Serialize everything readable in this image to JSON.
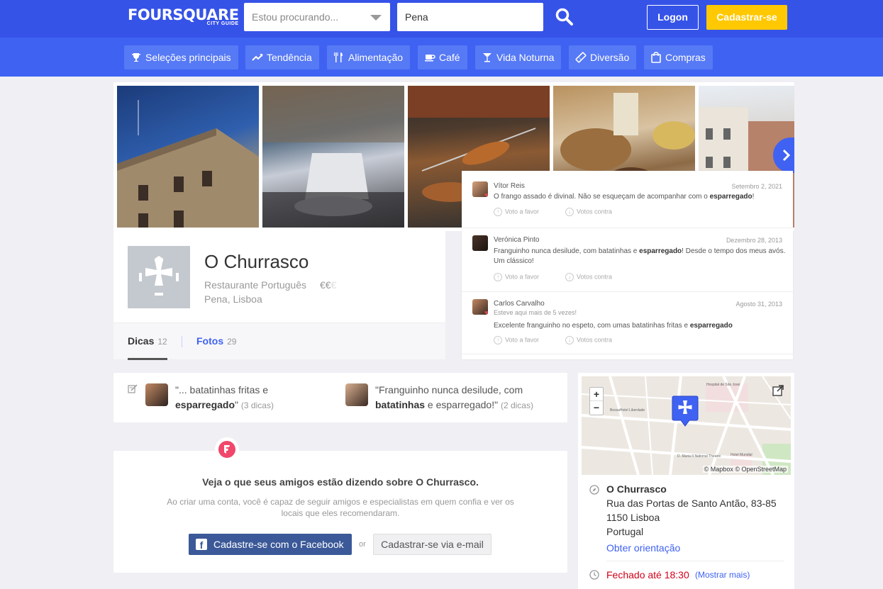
{
  "header": {
    "logo_main": "FOURSQUARE",
    "logo_sub": "CITY GUIDE",
    "search_placeholder": "Estou procurando...",
    "location_value": "Pena",
    "login_label": "Logon",
    "signup_label": "Cadastrar-se"
  },
  "categories": [
    {
      "label": "Seleções principais",
      "icon": "trophy-icon"
    },
    {
      "label": "Tendência",
      "icon": "trending-icon"
    },
    {
      "label": "Alimentação",
      "icon": "fork-knife-icon"
    },
    {
      "label": "Café",
      "icon": "coffee-cup-icon"
    },
    {
      "label": "Vida Noturna",
      "icon": "cocktail-icon"
    },
    {
      "label": "Diversão",
      "icon": "ticket-icon"
    },
    {
      "label": "Compras",
      "icon": "shopping-bag-icon"
    }
  ],
  "venue": {
    "name": "O Churrasco",
    "category": "Restaurante Português",
    "price_active": "€€",
    "price_inactive": "€",
    "location": "Pena, Lisboa",
    "tabs": [
      {
        "label": "Dicas",
        "count": "12"
      },
      {
        "label": "Fotos",
        "count": "29"
      }
    ]
  },
  "tips": [
    {
      "author": "Vítor Reis",
      "date": "Setembro 2, 2021",
      "text_pre": "O frango assado é divinal. Não se esqueçam de acompanhar com o ",
      "text_bold": "esparregado",
      "text_post": "!",
      "upvote": "Voto a favor",
      "downvote": "Votos contra"
    },
    {
      "author": "Verónica Pinto",
      "date": "Dezembro 28, 2013",
      "text_pre": "Franguinho nunca desilude, com batatinhas e ",
      "text_bold": "esparregado",
      "text_post": "! Desde o tempo dos meus avós. Um clássico!",
      "upvote": "Voto a favor",
      "downvote": "Votos contra"
    },
    {
      "author": "Carlos Carvalho",
      "subtitle": "Esteve aqui mais de 5 vezes!",
      "date": "Agosto 31, 2013",
      "text_pre": "Excelente franguinho no espeto, com umas batatinhas fritas e ",
      "text_bold": "esparregado",
      "text_post": "",
      "upvote": "Voto a favor",
      "downvote": "Votos contra"
    }
  ],
  "tip_summary": [
    {
      "pre": "\"... batatinhas fritas e ",
      "bold": "esparregado",
      "post": "\"",
      "count": "(3 dicas)"
    },
    {
      "pre": "\"Franguinho nunca desilude, com ",
      "bold": "batatinhas",
      "post": " e esparregado!\"",
      "count": "(2 dicas)"
    }
  ],
  "friends_cta": {
    "title": "Veja o que seus amigos estão dizendo sobre O Churrasco.",
    "description": "Ao criar uma conta, você é capaz de seguir amigos e especialistas em quem confia e ver os locais que eles recomendaram.",
    "facebook_label": "Cadastre-se com o Facebook",
    "or_label": "or",
    "email_label": "Cadastrar-se via e-mail"
  },
  "map": {
    "zoom_in": "+",
    "zoom_out": "−",
    "attribution": "© Mapbox © OpenStreetMap",
    "labels": [
      "Hospital de São José",
      "BessaHotel Liberdade",
      "D. Maria II National Theatre",
      "Hotel Mundial"
    ]
  },
  "address": {
    "name": "O Churrasco",
    "line1": "Rua das Portas de Santo Antão, 83-85",
    "line2": "1150 Lisboa",
    "line3": "Portugal",
    "directions": "Obter orientação",
    "hours": "Fechado até 18:30",
    "more": "(Mostrar mais)"
  },
  "colors": {
    "header_blue": "#3653e8",
    "nav_blue": "#3f62f2",
    "signup_yellow": "#ffc800",
    "closed_red": "#d0021b",
    "facebook_blue": "#3b5998"
  }
}
